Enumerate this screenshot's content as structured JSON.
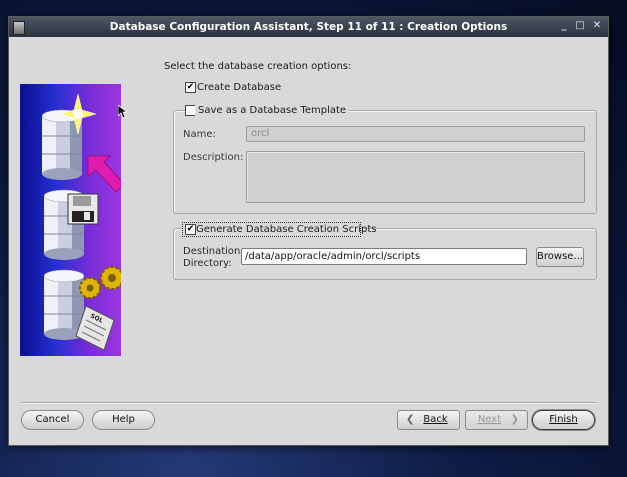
{
  "window": {
    "title": "Database Configuration Assistant, Step 11 of 11 : Creation Options",
    "controls": {
      "minimize": "_",
      "maximize": "□",
      "close": "✕"
    }
  },
  "main": {
    "prompt": "Select the database creation options:",
    "create_database": {
      "label": "Create Database",
      "checked": true
    },
    "template_group": {
      "label": "Save as a Database Template",
      "checked": false,
      "name_label": "Name:",
      "name_value": "orcl",
      "description_label": "Description:",
      "description_value": ""
    },
    "scripts_group": {
      "label": "Generate Database Creation Scripts",
      "checked": true,
      "dest_label_line1": "Destination",
      "dest_label_line2": "Directory:",
      "dest_value": "/data/app/oracle/admin/orcl/scripts",
      "browse_label": "Browse..."
    }
  },
  "footer": {
    "cancel": "Cancel",
    "help": "Help",
    "back": "Back",
    "next": "Next",
    "finish": "Finish"
  },
  "graphic": {
    "sql_label": "SQL"
  },
  "colors": {
    "accent_arrow": "#e01bb0",
    "panel_blue": "#1a24c8",
    "star": "#fff36b"
  }
}
